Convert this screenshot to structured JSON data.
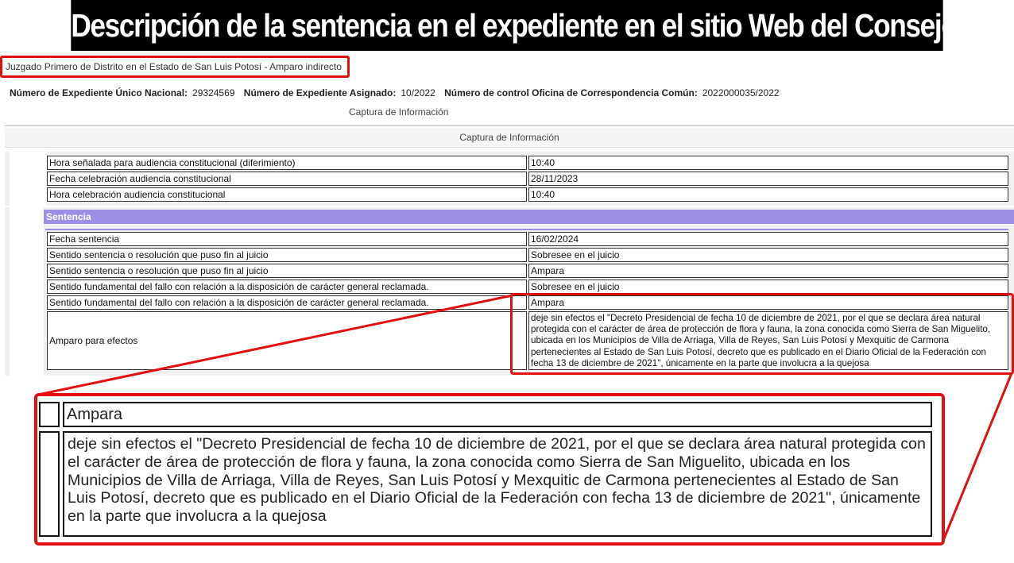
{
  "banner": {
    "title": "Descripción de la sentencia en el expediente en el sitio Web del Consejo de la Judicatura"
  },
  "court": {
    "name": "Juzgado Primero de Distrito en el Estado de San Luis Potosí - Amparo indirecto"
  },
  "expediente": {
    "nacional_label": "Número de Expediente Único Nacional:",
    "nacional_value": "29324569",
    "asignado_label": "Número de Expediente Asignado:",
    "asignado_value": "10/2022",
    "control_label": "Número de control Oficina de Correspondencia Común:",
    "control_value": "2022000035/2022"
  },
  "captura": {
    "title_1": "Captura de Información",
    "title_2": "Captura de Información"
  },
  "audiencia": [
    {
      "label": "Hora señalada para audiencia constitucional (diferimiento)",
      "value": "10:40"
    },
    {
      "label": "Fecha celebración audiencia constitucional",
      "value": "28/11/2023"
    },
    {
      "label": "Hora celebración audiencia constitucional",
      "value": "10:40"
    }
  ],
  "sentencia": {
    "header": "Sentencia",
    "rows": [
      {
        "label": "Fecha sentencia",
        "value": "16/02/2024"
      },
      {
        "label": "Sentido sentencia o resolución que puso fin al juicio",
        "value": "Sobresee en el juicio"
      },
      {
        "label": "Sentido sentencia o resolución que puso fin al juicio",
        "value": "Ampara"
      },
      {
        "label": "Sentido fundamental del fallo con relación a la disposición de carácter general reclamada.",
        "value": "Sobresee en el juicio"
      },
      {
        "label": "Sentido fundamental del fallo con relación a la disposición de carácter general reclamada.",
        "value": "Ampara"
      }
    ],
    "efectos_label": "Amparo para efectos",
    "efectos_value": "deje sin efectos el \"Decreto Presidencial de fecha 10 de diciembre de 2021, por el que se declara área natural protegida con el carácter de área de protección de flora y fauna, la zona conocida como Sierra de San Miguelito, ubicada en los Municipios de Villa de Arriaga, Villa de Reyes, San Luis Potosí y Mexquitic de Carmona pertenecientes al Estado de San Luis Potosí, decreto que es publicado en el Diario Oficial de la Federación con fecha 13 de diciembre de 2021\", únicamente en la parte que involucra a la quejosa"
  },
  "zoom": {
    "ampara": "Ampara",
    "text": "deje sin efectos el \"Decreto Presidencial de fecha 10 de diciembre de 2021, por el que se declara área natural protegida con el carácter de área de protección de flora y fauna, la zona conocida como Sierra de San Miguelito, ubicada en los Municipios de Villa de Arriaga, Villa de Reyes, San Luis Potosí y Mexquitic de Carmona pertenecientes al Estado de San Luis Potosí, decreto que es publicado en el Diario Oficial de la Federación con fecha 13 de diciembre de 2021\", únicamente en la parte que involucra a la quejosa"
  },
  "colors": {
    "highlight": "#e01010",
    "section_header": "#9b8fe6",
    "banner_bg": "#000000"
  }
}
